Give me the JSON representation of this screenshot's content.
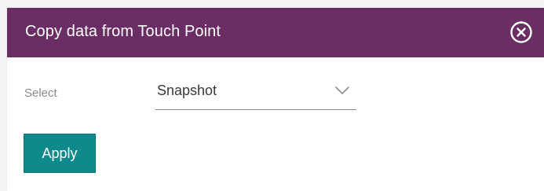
{
  "dialog": {
    "title": "Copy data from Touch Point",
    "close_icon": "close-circle-icon"
  },
  "form": {
    "select_label": "Select",
    "select_value": "Snapshot",
    "dropdown_icon": "chevron-down-icon"
  },
  "actions": {
    "apply_label": "Apply"
  },
  "colors": {
    "header_bg": "#6a2d64",
    "accent": "#0e8a8c",
    "label_text": "#8a8a8a",
    "value_text": "#3a3a3a"
  }
}
